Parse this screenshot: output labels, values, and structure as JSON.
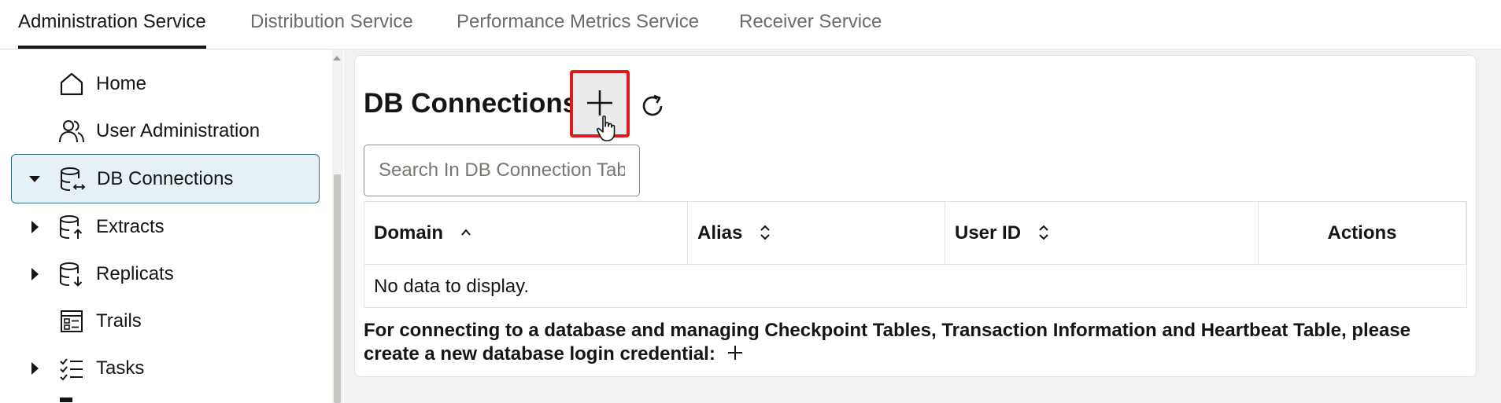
{
  "tabs": [
    {
      "label": "Administration Service",
      "active": true
    },
    {
      "label": "Distribution Service",
      "active": false
    },
    {
      "label": "Performance Metrics Service",
      "active": false
    },
    {
      "label": "Receiver Service",
      "active": false
    }
  ],
  "sidebar": {
    "items": [
      {
        "label": "Home",
        "icon": "home-icon",
        "expandable": false
      },
      {
        "label": "User Administration",
        "icon": "users-icon",
        "expandable": false
      },
      {
        "label": "DB Connections",
        "icon": "database-link-icon",
        "expandable": true,
        "expanded": true,
        "selected": true
      },
      {
        "label": "Extracts",
        "icon": "database-upload-icon",
        "expandable": true
      },
      {
        "label": "Replicats",
        "icon": "database-download-icon",
        "expandable": true
      },
      {
        "label": "Trails",
        "icon": "trails-icon",
        "expandable": false
      },
      {
        "label": "Tasks",
        "icon": "task-list-icon",
        "expandable": true
      }
    ]
  },
  "main": {
    "title": "DB Connections",
    "search": {
      "placeholder": "Search In DB Connection Table",
      "value": ""
    },
    "table": {
      "columns": [
        {
          "label": "Domain",
          "sort": "ascending"
        },
        {
          "label": "Alias",
          "sort": "none"
        },
        {
          "label": "User ID",
          "sort": "none"
        },
        {
          "label": "Actions",
          "sort": null
        }
      ],
      "empty_text": "No data to display."
    },
    "hint": "For connecting to a database and managing Checkpoint Tables, Transaction Information and Heartbeat Table, please create a new database login credential:"
  },
  "colors": {
    "highlight_border": "#e0191f",
    "selected_bg": "#e5f1f7",
    "accent": "#161513"
  }
}
